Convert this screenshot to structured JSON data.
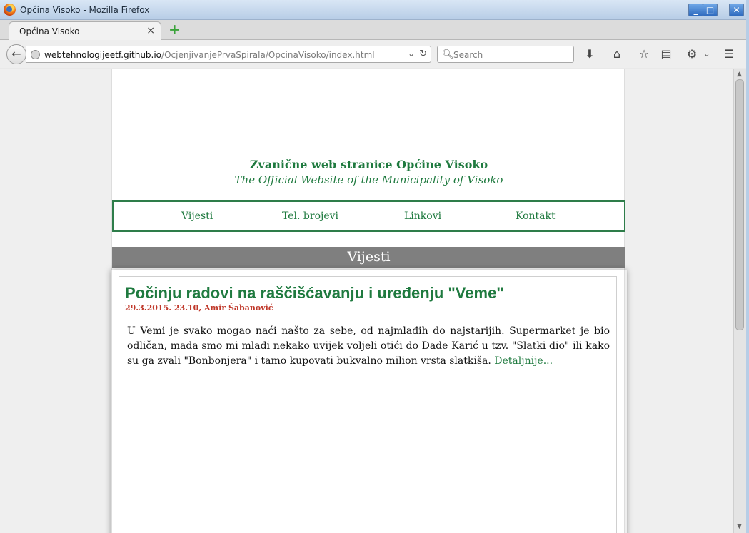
{
  "window": {
    "title": "Općina Visoko - Mozilla Firefox",
    "min_label": "_",
    "max_label": "□",
    "close_label": "✕"
  },
  "tabs": [
    {
      "label": "Općina Visoko",
      "close": "×"
    }
  ],
  "newtab_label": "+",
  "navbar": {
    "back_glyph": "←",
    "url_host": "webtehnologijeetf.github.io",
    "url_path": "/OcjenjivanjePrvaSpirala/OpcinaVisoko/index.html",
    "search_placeholder": "Search",
    "icons": [
      "download-icon",
      "home-icon",
      "bookmark-star-icon",
      "reading-list-icon",
      "addon-icon",
      "menu-icon"
    ]
  },
  "site": {
    "title": "Zvanične web stranice Općine Visoko",
    "subtitle": "The Official Website of the Municipality of Visoko",
    "menu": [
      "Vijesti",
      "Tel. brojevi",
      "Linkovi",
      "Kontakt"
    ],
    "section_title": "Vijesti",
    "accent_color": "#1f7a3f"
  },
  "article": {
    "title": "Počinju radovi na raščišćavanju i uređenju \"Veme\"",
    "meta": "29.3.2015. 23.10, Amir Šabanović",
    "body": "U Vemi je svako mogao naći našto za sebe, od najmlađih do najstarijih. Supermarket je bio odličan, mada smo mi mlađi nekako uvijek voljeli otići do Dade Karić u tzv. \"Slatki dio\" ili kako su ga zvali \"Bonbonjera\" i tamo kupovati bukvalno milion vrsta slatkiša.",
    "more": "Detaljnije..."
  }
}
